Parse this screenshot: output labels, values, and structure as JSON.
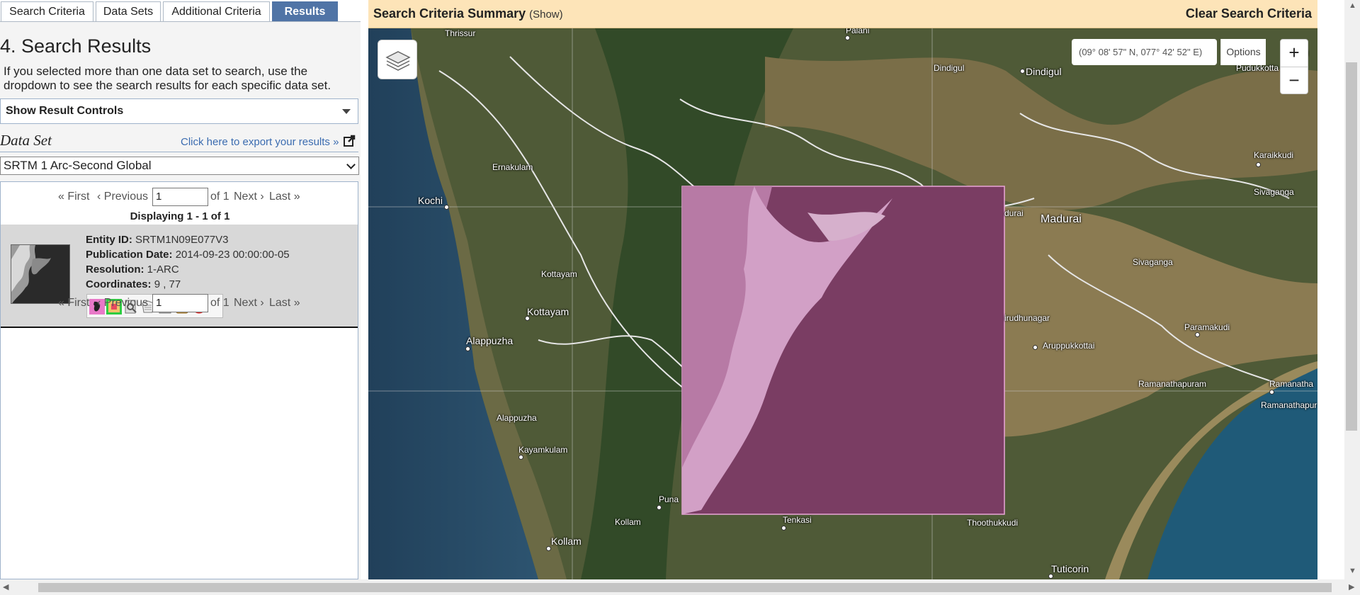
{
  "tabs": [
    "Search Criteria",
    "Data Sets",
    "Additional Criteria",
    "Results"
  ],
  "results_panel": {
    "heading": "4. Search Results",
    "intro": "If you selected more than one data set to search, use the dropdown to see the search results for each specific data set.",
    "controls_label": "Show Result Controls",
    "dataset_label": "Data Set",
    "export_link": "Click here to export your results »",
    "dataset_selected": "SRTM 1 Arc-Second Global",
    "pager": {
      "first": "« First",
      "previous": "‹ Previous",
      "page": "1",
      "of": "of 1",
      "next": "Next ›",
      "last": "Last »"
    },
    "displaying": "Displaying 1 - 1 of 1",
    "record": {
      "entity_label": "Entity ID:",
      "entity_value": "SRTM1N09E077V3",
      "pub_label": "Publication Date:",
      "pub_value": "2014-09-23 00:00:00-05",
      "res_label": "Resolution:",
      "res_value": "1-ARC",
      "coord_label": "Coordinates:",
      "coord_value": "9 , 77"
    }
  },
  "map": {
    "summary_title": "Search Criteria Summary",
    "summary_show": "(Show)",
    "clear": "Clear Search Criteria",
    "coords": "(09° 08' 57\" N, 077° 42' 52\" E)",
    "options": "Options",
    "zoom_in": "+",
    "zoom_out": "−",
    "places": {
      "thrissur": "Thrissur",
      "palani": "Palani",
      "dindigul_a": "Dindigul",
      "dindigul_b": "Dindigul",
      "pudukkottai": "Pudukkotta",
      "pu": "Pu",
      "ernakulam": "Ernakulam",
      "kochi": "Kochi",
      "karaikkudi": "Karaikkudi",
      "sivaganga_a": "Sivaganga",
      "madurai": "Madurai",
      "durai": "durai",
      "sivaganga_b": "Sivaganga",
      "kottayam_a": "Kottayam",
      "kottayam_b": "Kottayam",
      "alappuzha_a": "Alappuzha",
      "virudhunagar": "irudhunagar",
      "aruppukkottai": "Aruppukkottai",
      "paramakudi": "Paramakudi",
      "alappuzha_b": "Alappuzha",
      "ramanathapuram_a": "Ramanathapuram",
      "ramanatha": "Ramanatha",
      "ramanathapur": "Ramanathapur",
      "kayamkulam": "Kayamkulam",
      "punalur": "Puna",
      "kollam_a": "Kollam",
      "tenkasi": "Tenkasi",
      "thoothukkudi": "Thoothukkudi",
      "kollam_b": "Kollam",
      "tuticorin": "Tuticorin"
    }
  }
}
